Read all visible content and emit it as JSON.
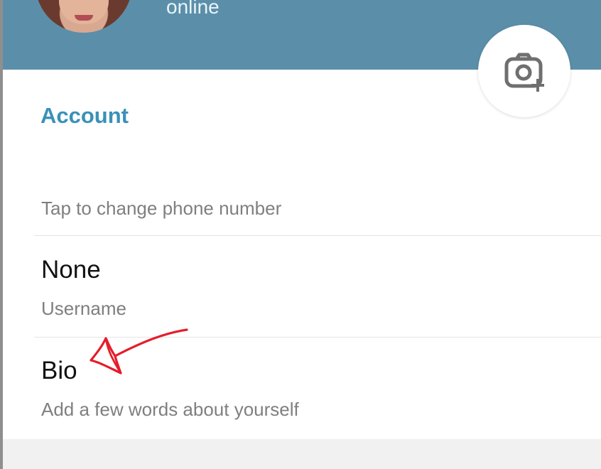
{
  "profile": {
    "status_text": "online",
    "avatar_name": "profile-avatar",
    "camera_icon": "camera-plus-icon"
  },
  "section": {
    "title": "Account"
  },
  "phone_row": {
    "secondary": "Tap to change phone number"
  },
  "username_row": {
    "primary": "None",
    "secondary": "Username"
  },
  "bio_row": {
    "primary": "Bio",
    "secondary": "Add a few words about yourself"
  },
  "annotation": {
    "icon": "hand-drawn-arrow-icon",
    "color": "#e51c2a"
  },
  "colors": {
    "header": "#5b8fa9",
    "accent": "#3a91b8"
  }
}
